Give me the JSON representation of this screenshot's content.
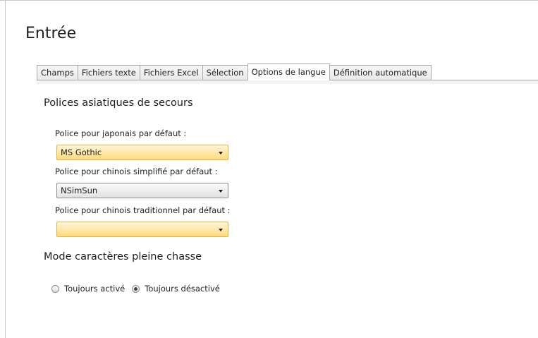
{
  "page": {
    "title": "Entrée"
  },
  "tabs": [
    {
      "label": "Champs",
      "active": false
    },
    {
      "label": "Fichiers texte",
      "active": false
    },
    {
      "label": "Fichiers Excel",
      "active": false
    },
    {
      "label": "Sélection",
      "active": false
    },
    {
      "label": "Options de langue",
      "active": true
    },
    {
      "label": "Définition automatique",
      "active": false
    }
  ],
  "asian_fonts": {
    "heading": "Polices asiatiques de secours",
    "japanese": {
      "label": "Police pour japonais par défaut :",
      "value": "MS Gothic"
    },
    "chinese_simplified": {
      "label": "Police pour chinois simplifié par défaut :",
      "value": "NSimSun"
    },
    "chinese_traditional": {
      "label": "Police pour chinois traditionnel par défaut :",
      "value": ""
    }
  },
  "fullwidth": {
    "heading": "Mode caractères pleine chasse",
    "options": [
      {
        "label": "Toujours activé",
        "checked": false
      },
      {
        "label": "Toujours désactivé",
        "checked": true
      }
    ]
  },
  "colors": {
    "highlight_combo": "#ffdb7b",
    "highlight_border": "#e4b23a",
    "tab_border": "#a9a9a9"
  }
}
